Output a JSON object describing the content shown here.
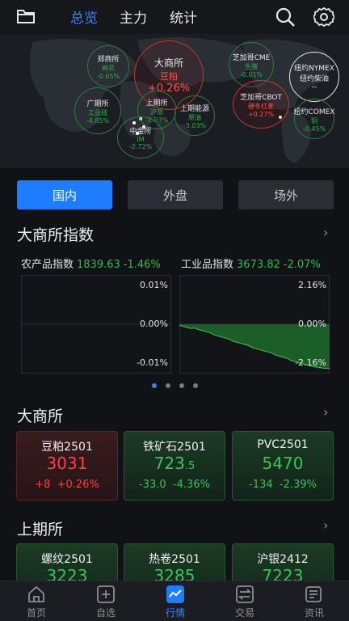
{
  "header": {
    "tabs": [
      {
        "label": "总览",
        "active": true
      },
      {
        "label": "主力",
        "active": false
      },
      {
        "label": "统计",
        "active": false
      }
    ]
  },
  "map": {
    "exchanges": [
      {
        "name": "郑商所",
        "commodity": "棉花",
        "pct": "-0.65%",
        "trend": "down"
      },
      {
        "name": "大商所",
        "commodity": "豆粕",
        "pct": "+0.26%",
        "trend": "up"
      },
      {
        "name": "芝加哥CME",
        "commodity": "生猪",
        "pct": "-0.01%",
        "trend": "down"
      },
      {
        "name": "纽约NYMEX",
        "commodity": "纽约柴油",
        "pct": "--",
        "trend": "flat"
      },
      {
        "name": "广期所",
        "commodity": "工业硅",
        "pct": "-4.85%",
        "trend": "down"
      },
      {
        "name": "上期所",
        "commodity": "沪银",
        "pct": "-2.93%",
        "trend": "down"
      },
      {
        "name": "上期能源",
        "commodity": "原油",
        "pct": "-3.03%",
        "trend": "down"
      },
      {
        "name": "芝加哥CBOT",
        "commodity": "硬冬红麦",
        "pct": "+0.27%",
        "trend": "up"
      },
      {
        "name": "纽约COMEX",
        "commodity": "铜",
        "pct": "-0.45%",
        "trend": "down"
      },
      {
        "name": "中金所",
        "commodity": "IM",
        "pct": "-2.72%",
        "trend": "down"
      }
    ]
  },
  "segments": [
    {
      "label": "国内",
      "active": true
    },
    {
      "label": "外盘",
      "active": false
    },
    {
      "label": "场外",
      "active": false
    }
  ],
  "dce_index": {
    "title": "大商所指数",
    "left": {
      "name": "农产品指数",
      "value": "1839.63",
      "pct": "-1.46%",
      "ticks": [
        "0.01%",
        "0.00%",
        "-0.01%"
      ]
    },
    "right": {
      "name": "工业品指数",
      "value": "3673.82",
      "pct": "-2.07%",
      "ticks": [
        "2.16%",
        "0.00%",
        "-2.16%"
      ]
    }
  },
  "chart_data": {
    "type": "area",
    "title": "工业品指数",
    "xlabel": "",
    "ylabel": "",
    "ylim": [
      -2.16,
      2.16
    ],
    "x": [
      0,
      1,
      2,
      3,
      4,
      5,
      6,
      7,
      8,
      9,
      10,
      11,
      12,
      13,
      14,
      15,
      16,
      17,
      18,
      19,
      20,
      21,
      22,
      23,
      24,
      25,
      26,
      27,
      28,
      29,
      30,
      31,
      32,
      33,
      34,
      35,
      36,
      37,
      38,
      39
    ],
    "series": [
      {
        "values": [
          -0.05,
          -0.1,
          -0.15,
          -0.2,
          -0.18,
          -0.25,
          -0.3,
          -0.35,
          -0.4,
          -0.5,
          -0.55,
          -0.6,
          -0.65,
          -0.7,
          -0.8,
          -0.85,
          -0.9,
          -0.95,
          -1.0,
          -1.1,
          -1.15,
          -1.2,
          -1.25,
          -1.3,
          -1.35,
          -1.45,
          -1.5,
          -1.55,
          -1.6,
          -1.7,
          -1.75,
          -1.8,
          -1.85,
          -1.9,
          -1.95,
          -2.0,
          -2.02,
          -2.05,
          -2.07,
          -2.07
        ]
      }
    ],
    "grid": true
  },
  "page_dots": {
    "count": 4,
    "active": 0
  },
  "dce": {
    "title": "大商所",
    "cards": [
      {
        "name": "豆粕2501",
        "price": "3031",
        "price_small": "",
        "chg": "+8",
        "pct": "+0.26%",
        "trend": "up"
      },
      {
        "name": "铁矿石2501",
        "price": "723",
        "price_small": ".5",
        "chg": "-33.0",
        "pct": "-4.36%",
        "trend": "down"
      },
      {
        "name": "PVC2501",
        "price": "5470",
        "price_small": "",
        "chg": "-134",
        "pct": "-2.39%",
        "trend": "down"
      }
    ]
  },
  "shfe": {
    "title": "上期所",
    "cards": [
      {
        "name": "螺纹2501",
        "price": "3223",
        "price_small": "",
        "trend": "down"
      },
      {
        "name": "热卷2501",
        "price": "3285",
        "price_small": "",
        "trend": "down"
      },
      {
        "name": "沪银2412",
        "price": "7223",
        "price_small": "",
        "trend": "down"
      }
    ]
  },
  "bottom_nav": [
    {
      "label": "首页",
      "icon": "home-icon",
      "active": false
    },
    {
      "label": "自选",
      "icon": "plus-square-icon",
      "active": false
    },
    {
      "label": "行情",
      "icon": "chart-icon",
      "active": true
    },
    {
      "label": "交易",
      "icon": "exchange-icon",
      "active": false
    },
    {
      "label": "资讯",
      "icon": "news-icon",
      "active": false
    }
  ],
  "colors": {
    "accent": "#1e7cff",
    "up": "#ff4040",
    "down": "#37c556"
  }
}
